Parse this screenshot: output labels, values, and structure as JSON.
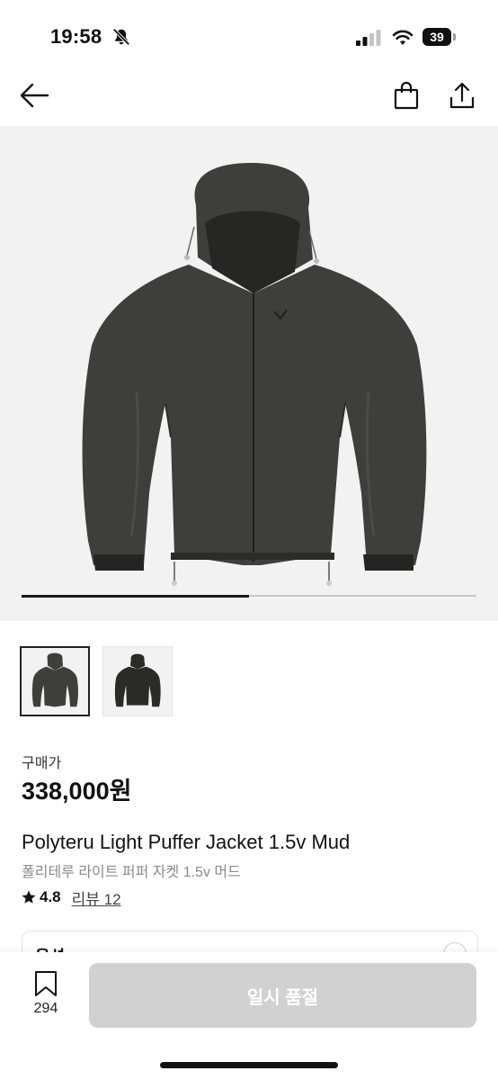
{
  "status_bar": {
    "time": "19:58",
    "battery": "39",
    "icons": [
      "mute-bell-icon",
      "cellular-signal-icon",
      "wifi-icon",
      "battery-icon"
    ]
  },
  "nav": {
    "icons": [
      "arrow-left-icon",
      "shopping-bag-icon",
      "share-icon"
    ]
  },
  "gallery": {
    "image_count": 2,
    "current_index": 1,
    "progress": 0.5,
    "image": "dark-hooded-puffer-jacket"
  },
  "product": {
    "price_label": "구매가",
    "price": "338,000원",
    "name": "Polyteru Light Puffer Jacket 1.5v Mud",
    "name_ko": "폴리테루 라이트 퍼퍼 자켓 1.5v 머드",
    "rating": "4.8",
    "review_link": "리뷰 12"
  },
  "options": {
    "label": "옵션"
  },
  "bottom_bar": {
    "wishlist_count": "294",
    "soldout_label": "일시 품절"
  },
  "colors": {
    "accent": "#111111",
    "disabled_button": "#d1d1d1",
    "gallery_bg": "#f2f2f2",
    "jacket": "#3e3e3b"
  }
}
